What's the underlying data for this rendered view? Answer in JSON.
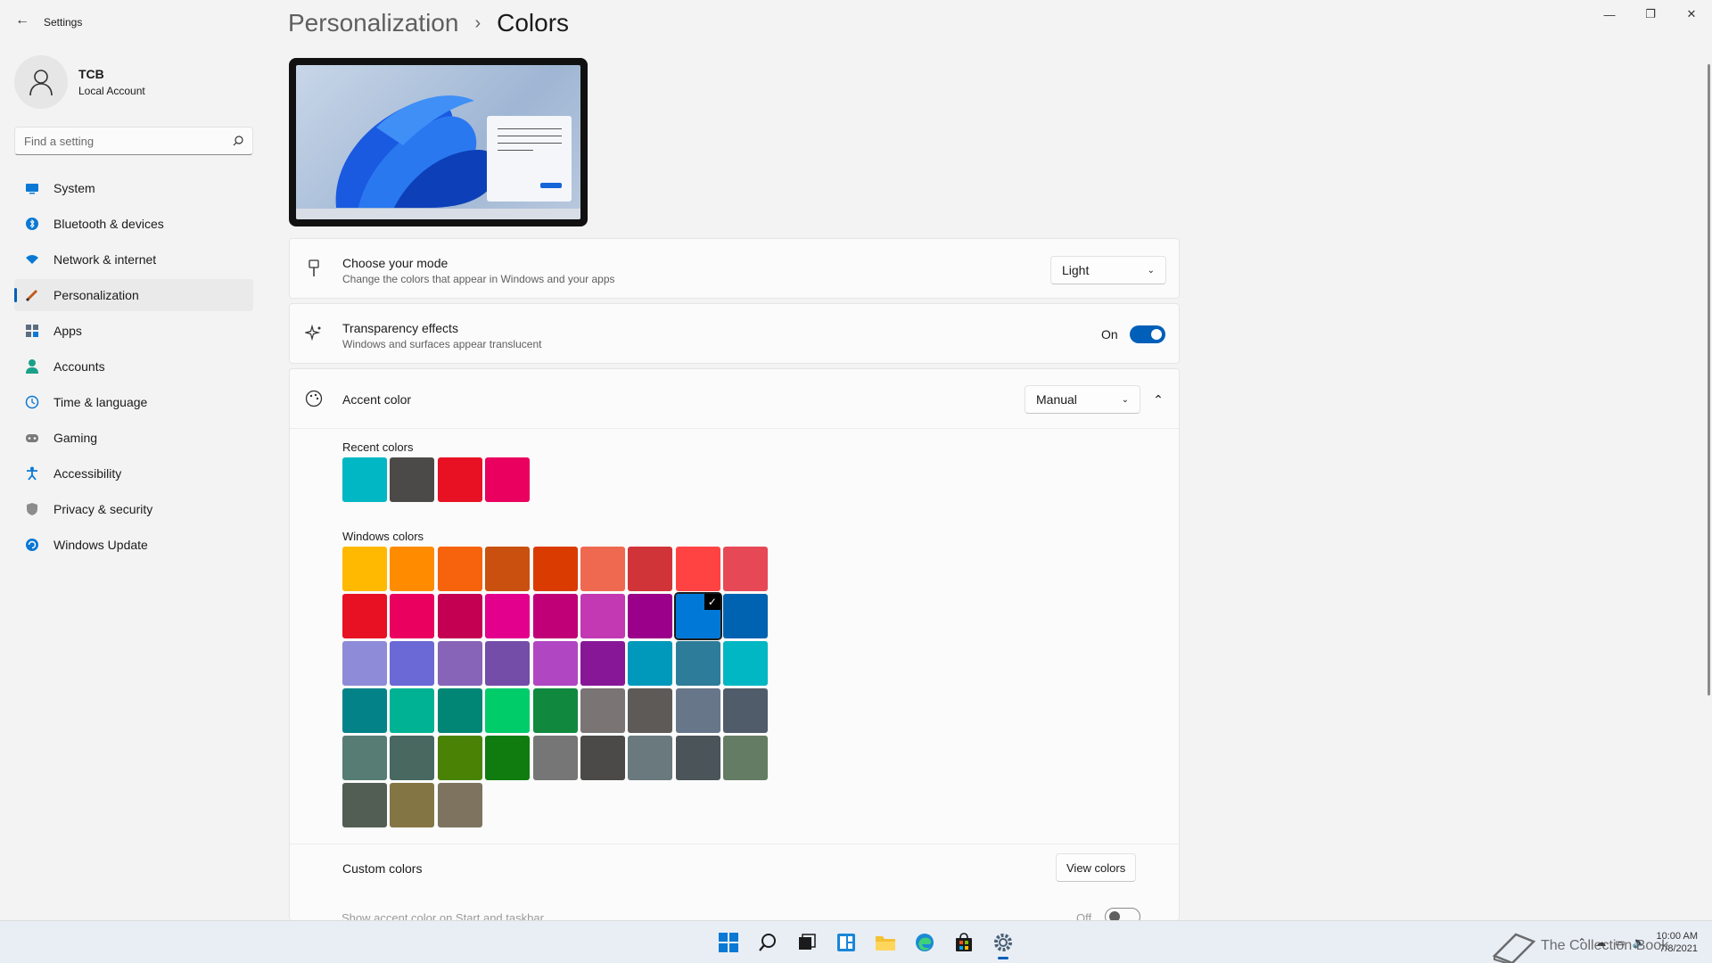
{
  "window": {
    "title": "Settings",
    "back_icon": "back-arrow-icon",
    "controls": [
      "minimize-icon",
      "restore-icon",
      "close-icon"
    ]
  },
  "profile": {
    "name": "TCB",
    "account_type": "Local Account"
  },
  "search": {
    "placeholder": "Find a setting"
  },
  "sidebar": {
    "items": [
      {
        "label": "System",
        "icon": "monitor-icon"
      },
      {
        "label": "Bluetooth & devices",
        "icon": "bluetooth-icon"
      },
      {
        "label": "Network & internet",
        "icon": "wifi-icon"
      },
      {
        "label": "Personalization",
        "icon": "brush-icon",
        "active": true
      },
      {
        "label": "Apps",
        "icon": "apps-icon"
      },
      {
        "label": "Accounts",
        "icon": "person-icon"
      },
      {
        "label": "Time & language",
        "icon": "globe-clock-icon"
      },
      {
        "label": "Gaming",
        "icon": "gamepad-icon"
      },
      {
        "label": "Accessibility",
        "icon": "accessibility-icon"
      },
      {
        "label": "Privacy & security",
        "icon": "shield-icon"
      },
      {
        "label": "Windows Update",
        "icon": "update-icon"
      }
    ]
  },
  "breadcrumb": {
    "parent": "Personalization",
    "separator": "›",
    "current": "Colors"
  },
  "mode": {
    "title": "Choose your mode",
    "description": "Change the colors that appear in Windows and your apps",
    "value": "Light"
  },
  "transparency": {
    "title": "Transparency effects",
    "description": "Windows and surfaces appear translucent",
    "state_label": "On",
    "enabled": true
  },
  "accent": {
    "title": "Accent color",
    "value": "Manual",
    "recent_label": "Recent colors",
    "recent_colors": [
      "#00b7c3",
      "#4c4a48",
      "#e81123",
      "#ea005e"
    ],
    "windows_label": "Windows colors",
    "windows_colors": [
      [
        "#ffb900",
        "#ff8c00",
        "#f7630c",
        "#ca5010",
        "#da3b01",
        "#ef6950",
        "#d13438",
        "#ff4343",
        "#e74856"
      ],
      [
        "#e81123",
        "#ea005e",
        "#c30052",
        "#e3008c",
        "#bf0077",
        "#c239b3",
        "#9a0089",
        "#0078d7",
        "#0063b1"
      ],
      [
        "#8e8cd8",
        "#6b69d6",
        "#8764b8",
        "#744da9",
        "#b146c2",
        "#881798",
        "#0099bc",
        "#2d7d9a",
        "#00b7c3"
      ],
      [
        "#038387",
        "#00b294",
        "#018574",
        "#00cc6a",
        "#10893e",
        "#7a7574",
        "#5d5a58",
        "#68768a",
        "#515c6b"
      ],
      [
        "#567c73",
        "#486860",
        "#498205",
        "#107c10",
        "#767676",
        "#4c4a48",
        "#69797e",
        "#4a5459",
        "#647c64"
      ],
      [
        "#525e54",
        "#847545",
        "#7e735f"
      ]
    ],
    "selected_color": "#0078d7"
  },
  "custom": {
    "title": "Custom colors",
    "button": "View colors"
  },
  "start_taskbar": {
    "title": "Show accent color on Start and taskbar",
    "state_label": "Off",
    "enabled": false
  },
  "taskbar": {
    "icons": [
      "start-icon",
      "search-icon",
      "task-view-icon",
      "widgets-icon",
      "file-explorer-icon",
      "edge-icon",
      "store-icon",
      "settings-icon"
    ],
    "clock_time": "10:00 AM",
    "clock_date": "7/8/2021"
  },
  "watermark": {
    "text": "The Collection Book"
  }
}
